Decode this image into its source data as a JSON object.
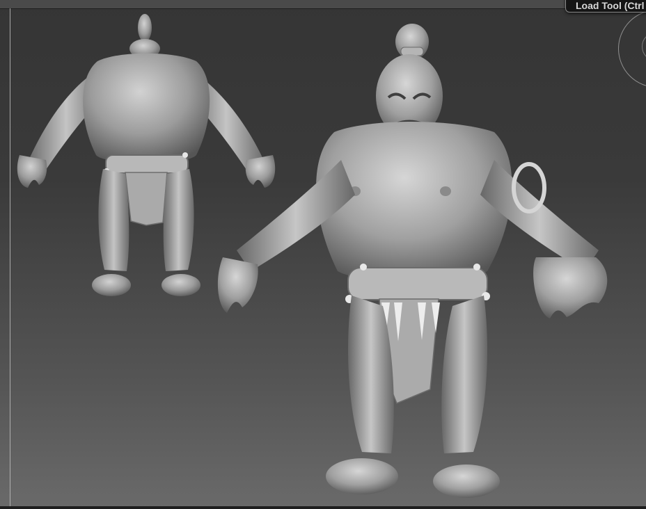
{
  "tooltip": {
    "label": "Load Tool (Ctrl"
  },
  "colors": {
    "viewport_top": "#353535",
    "viewport_bottom": "#6a6a6a",
    "clay": "#9a9a9a",
    "clay_highlight": "#cfcfcf",
    "clay_shadow": "#4a4a4a",
    "tooltip_bg": "#151515"
  },
  "viewport": {
    "figures": [
      {
        "name": "ogre-back-view"
      },
      {
        "name": "ogre-front-view"
      }
    ]
  }
}
